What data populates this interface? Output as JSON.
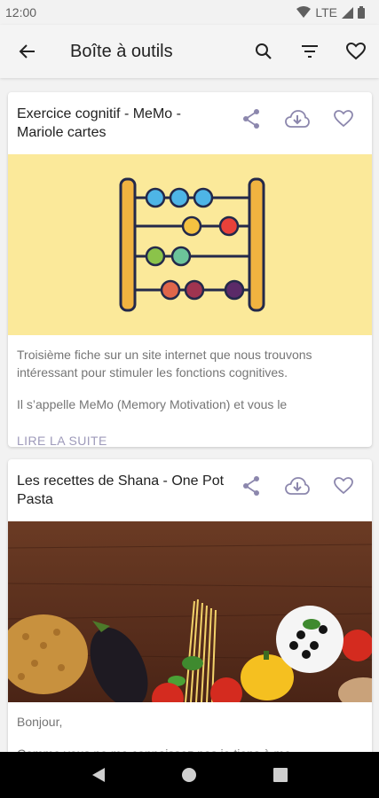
{
  "status": {
    "time": "12:00",
    "network": "LTE"
  },
  "app_bar": {
    "title": "Boîte à outils"
  },
  "cards": [
    {
      "title": "Exercice cognitif - MeMo - Mariole cartes",
      "paragraphs": [
        "Troisième fiche sur un site internet que nous trouvons intéressant pour stimuler les fonctions cognitives.",
        "Il s’appelle MeMo (Memory Motivation) et vous le"
      ],
      "read_more": "LIRE LA SUITE"
    },
    {
      "title": "Les recettes de Shana - One Pot Pasta",
      "paragraphs": [
        "Bonjour,",
        "Comme vous ne me connaissez pas je tiens à me"
      ]
    }
  ],
  "colors": {
    "accent": "#8c87ad",
    "abacus_bg": "#fbe99a",
    "wood": "#5a3324"
  },
  "icons": [
    "back-arrow-icon",
    "search-icon",
    "filter-icon",
    "heart-icon",
    "share-icon",
    "cloud-download-icon"
  ]
}
